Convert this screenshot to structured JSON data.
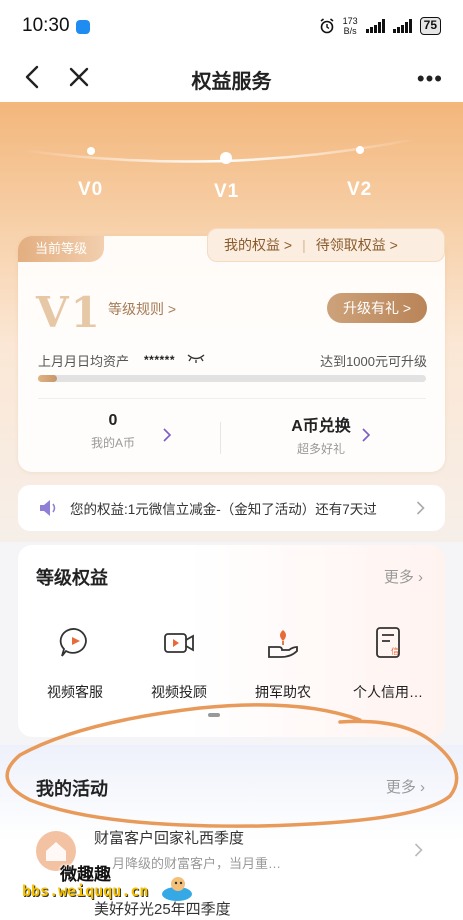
{
  "status_bar": {
    "time": "10:30",
    "speed_value": "173",
    "speed_unit": "B/s",
    "battery": "75"
  },
  "nav": {
    "title": "权益服务"
  },
  "levels": {
    "labels": [
      "V0",
      "V1",
      "V2"
    ],
    "current_index": 1
  },
  "level_card": {
    "badge": "当前等级",
    "my_rights": "我的权益 >",
    "pending_rights": "待领取权益 >",
    "level_big": "V1",
    "rules": "等级规则 >",
    "upgrade_button": "升级有礼 >",
    "asset_label": "上月月日均资产",
    "asset_value": "******",
    "upgrade_hint": "达到1000元可升级",
    "progress_fraction": 0.05,
    "stat_left_main": "0",
    "stat_left_sub": "我的A币",
    "stat_right_main": "A币兑换",
    "stat_right_sub": "超多好礼"
  },
  "notice": {
    "text": "您的权益:1元微信立减金-（金知了活动）还有7天过"
  },
  "benefits": {
    "title": "等级权益",
    "more": "更多",
    "items": [
      {
        "label": "视频客服",
        "icon": "video-chat-icon"
      },
      {
        "label": "视频投顾",
        "icon": "video-camera-icon"
      },
      {
        "label": "拥军助农",
        "icon": "plant-hand-icon"
      },
      {
        "label": "个人信用…",
        "icon": "credit-document-icon"
      }
    ]
  },
  "activities": {
    "title": "我的活动",
    "more": "更多",
    "item1_title": "财富客户回家礼西季度",
    "item1_sub": "月降级的财富客户，当月重…",
    "item2_title": "美好好光25年四季度"
  },
  "watermark": {
    "top": "微趣趣",
    "bottom": "bbs.weiququ.cn"
  },
  "colors": {
    "accent": "#c7956a",
    "hero_top": "#f3b67b",
    "annotation": "#e89a5a"
  }
}
